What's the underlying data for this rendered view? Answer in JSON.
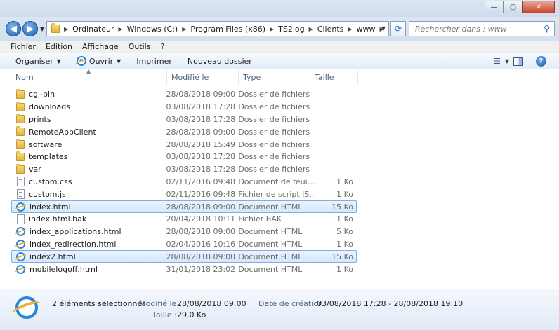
{
  "window": {
    "min_glyph": "—",
    "max_glyph": "▢",
    "close_glyph": "✕"
  },
  "address": {
    "crumbs": [
      "Ordinateur",
      "Windows (C:)",
      "Program Files (x86)",
      "TS2log",
      "Clients",
      "www"
    ]
  },
  "search": {
    "placeholder": "Rechercher dans : www"
  },
  "menu": {
    "items": [
      "Fichier",
      "Edition",
      "Affichage",
      "Outils",
      "?"
    ]
  },
  "toolbar": {
    "organize": "Organiser",
    "open": "Ouvrir",
    "print": "Imprimer",
    "new_folder": "Nouveau dossier"
  },
  "columns": {
    "name": "Nom",
    "modified": "Modifié le",
    "type": "Type",
    "size": "Taille"
  },
  "files": [
    {
      "name": "cgi-bin",
      "date": "28/08/2018 09:00",
      "type": "Dossier de fichiers",
      "size": "",
      "icon": "folder-icon",
      "selected": false
    },
    {
      "name": "downloads",
      "date": "03/08/2018 17:28",
      "type": "Dossier de fichiers",
      "size": "",
      "icon": "folder-icon",
      "selected": false
    },
    {
      "name": "prints",
      "date": "03/08/2018 17:28",
      "type": "Dossier de fichiers",
      "size": "",
      "icon": "folder-icon",
      "selected": false
    },
    {
      "name": "RemoteAppClient",
      "date": "28/08/2018 09:00",
      "type": "Dossier de fichiers",
      "size": "",
      "icon": "folder-icon",
      "selected": false
    },
    {
      "name": "software",
      "date": "28/08/2018 15:49",
      "type": "Dossier de fichiers",
      "size": "",
      "icon": "folder-icon",
      "selected": false
    },
    {
      "name": "templates",
      "date": "03/08/2018 17:28",
      "type": "Dossier de fichiers",
      "size": "",
      "icon": "folder-icon",
      "selected": false
    },
    {
      "name": "var",
      "date": "03/08/2018 17:28",
      "type": "Dossier de fichiers",
      "size": "",
      "icon": "folder-icon",
      "selected": false
    },
    {
      "name": "custom.css",
      "date": "02/11/2016 09:48",
      "type": "Document de feui...",
      "size": "1 Ko",
      "icon": "stylesheet-file-icon",
      "selected": false
    },
    {
      "name": "custom.js",
      "date": "02/11/2016 09:48",
      "type": "Fichier de script JS...",
      "size": "1 Ko",
      "icon": "script-file-icon",
      "selected": false
    },
    {
      "name": "index.html",
      "date": "28/08/2018 09:00",
      "type": "Document HTML",
      "size": "15 Ko",
      "icon": "html-file-icon",
      "selected": true
    },
    {
      "name": "index.html.bak",
      "date": "20/04/2018 10:11",
      "type": "Fichier BAK",
      "size": "1 Ko",
      "icon": "bak-file-icon",
      "selected": false
    },
    {
      "name": "index_applications.html",
      "date": "28/08/2018 09:00",
      "type": "Document HTML",
      "size": "5 Ko",
      "icon": "html-file-icon",
      "selected": false
    },
    {
      "name": "index_redirection.html",
      "date": "02/04/2016 10:16",
      "type": "Document HTML",
      "size": "1 Ko",
      "icon": "html-file-icon",
      "selected": false
    },
    {
      "name": "index2.html",
      "date": "28/08/2018 09:00",
      "type": "Document HTML",
      "size": "15 Ko",
      "icon": "html-file-icon",
      "selected": true
    },
    {
      "name": "mobilelogoff.html",
      "date": "31/01/2018 23:02",
      "type": "Document HTML",
      "size": "1 Ko",
      "icon": "html-file-icon",
      "selected": false
    }
  ],
  "details": {
    "count": "2 éléments sélectionnés",
    "modified_label": "Modifié le :",
    "modified_value": "28/08/2018 09:00",
    "created_label": "Date de création :",
    "created_value": "03/08/2018 17:28 - 28/08/2018 19:10",
    "size_label": "Taille :",
    "size_value": "29,0 Ko"
  },
  "colors": {
    "selection_bg": "#d5e7fb",
    "selection_border": "#84acdd",
    "accent": "#2a86d8"
  }
}
